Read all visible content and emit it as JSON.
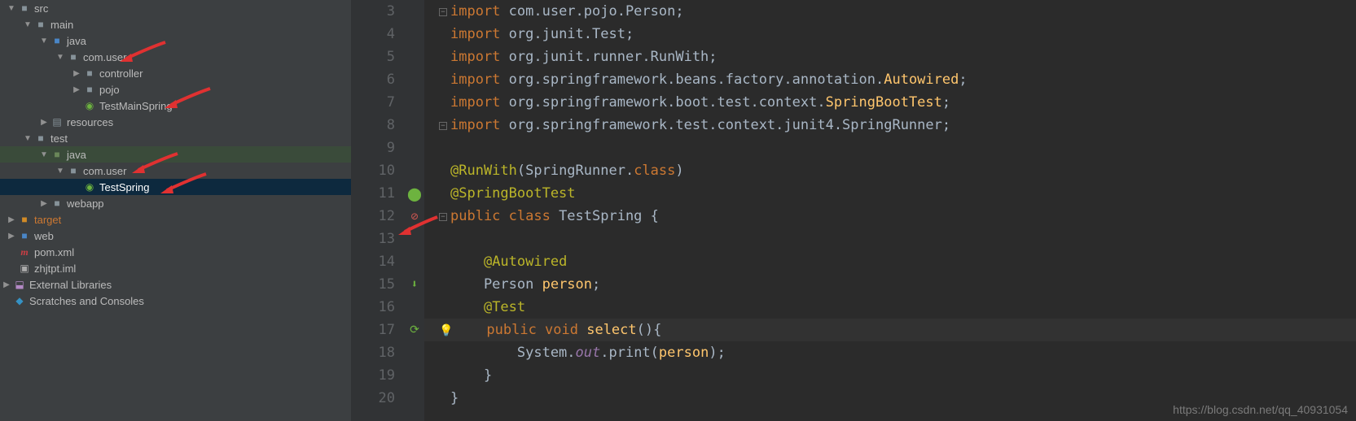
{
  "tree": {
    "src": "src",
    "main": "main",
    "java1": "java",
    "com_user1": "com.user",
    "controller": "controller",
    "pojo": "pojo",
    "testmainspring": "TestMainSpring",
    "resources": "resources",
    "test": "test",
    "java2": "java",
    "com_user2": "com.user",
    "testspring": "TestSpring",
    "webapp": "webapp",
    "target": "target",
    "web": "web",
    "pom": "pom.xml",
    "iml": "zhjtpt.iml",
    "ext_lib": "External Libraries",
    "scratches": "Scratches and Consoles"
  },
  "code": {
    "lines": [
      {
        "n": 3,
        "t": [
          [
            "kw",
            "import "
          ],
          [
            "pkg",
            "com.user.pojo.Person"
          ],
          [
            "str",
            ";"
          ]
        ]
      },
      {
        "n": 4,
        "t": [
          [
            "kw",
            "import "
          ],
          [
            "pkg",
            "org.junit.Test"
          ],
          [
            "str",
            ";"
          ]
        ]
      },
      {
        "n": 5,
        "t": [
          [
            "kw",
            "import "
          ],
          [
            "pkg",
            "org.junit.runner.RunWith"
          ],
          [
            "str",
            ";"
          ]
        ]
      },
      {
        "n": 6,
        "t": [
          [
            "kw",
            "import "
          ],
          [
            "pkg",
            "org.springframework.beans.factory.annotation."
          ],
          [
            "id",
            "Autowired"
          ],
          [
            "str",
            ";"
          ]
        ]
      },
      {
        "n": 7,
        "t": [
          [
            "kw",
            "import "
          ],
          [
            "pkg",
            "org.springframework.boot.test.context."
          ],
          [
            "id",
            "SpringBootTest"
          ],
          [
            "str",
            ";"
          ]
        ]
      },
      {
        "n": 8,
        "t": [
          [
            "kw",
            "import "
          ],
          [
            "pkg",
            "org.springframework.test.context.junit4.SpringRunner"
          ],
          [
            "str",
            ";"
          ]
        ]
      },
      {
        "n": 9,
        "t": []
      },
      {
        "n": 10,
        "t": [
          [
            "ann",
            "@RunWith"
          ],
          [
            "str",
            "(SpringRunner."
          ],
          [
            "kw",
            "class"
          ],
          [
            "str",
            ")"
          ]
        ]
      },
      {
        "n": 11,
        "t": [
          [
            "ann",
            "@SpringBootTest"
          ]
        ]
      },
      {
        "n": 12,
        "t": [
          [
            "kw",
            "public class "
          ],
          [
            "cls",
            "TestSpring {"
          ]
        ]
      },
      {
        "n": 13,
        "t": []
      },
      {
        "n": 14,
        "t": [
          [
            "str",
            "    "
          ],
          [
            "ann",
            "@Autowired"
          ]
        ]
      },
      {
        "n": 15,
        "t": [
          [
            "str",
            "    Person "
          ],
          [
            "id",
            "person"
          ],
          [
            "str",
            ";"
          ]
        ]
      },
      {
        "n": 16,
        "t": [
          [
            "str",
            "    "
          ],
          [
            "ann",
            "@Test"
          ]
        ]
      },
      {
        "n": 17,
        "t": [
          [
            "str",
            "    "
          ],
          [
            "kw",
            "public void "
          ],
          [
            "id",
            "select"
          ],
          [
            "str",
            "(){"
          ]
        ],
        "hl": true,
        "bulb": true
      },
      {
        "n": 18,
        "t": [
          [
            "str",
            "        System."
          ],
          [
            "static",
            "out"
          ],
          [
            "str",
            ".print("
          ],
          [
            "id",
            "person"
          ],
          [
            "str",
            ");"
          ]
        ]
      },
      {
        "n": 19,
        "t": [
          [
            "str",
            "    }"
          ]
        ]
      },
      {
        "n": 20,
        "t": [
          [
            "str",
            "}"
          ]
        ]
      }
    ],
    "gutter_icons": {
      "11": "spring",
      "12": "error",
      "15": "nav-down",
      "17": "nav-up"
    }
  },
  "watermark": "https://blog.csdn.net/qq_40931054"
}
